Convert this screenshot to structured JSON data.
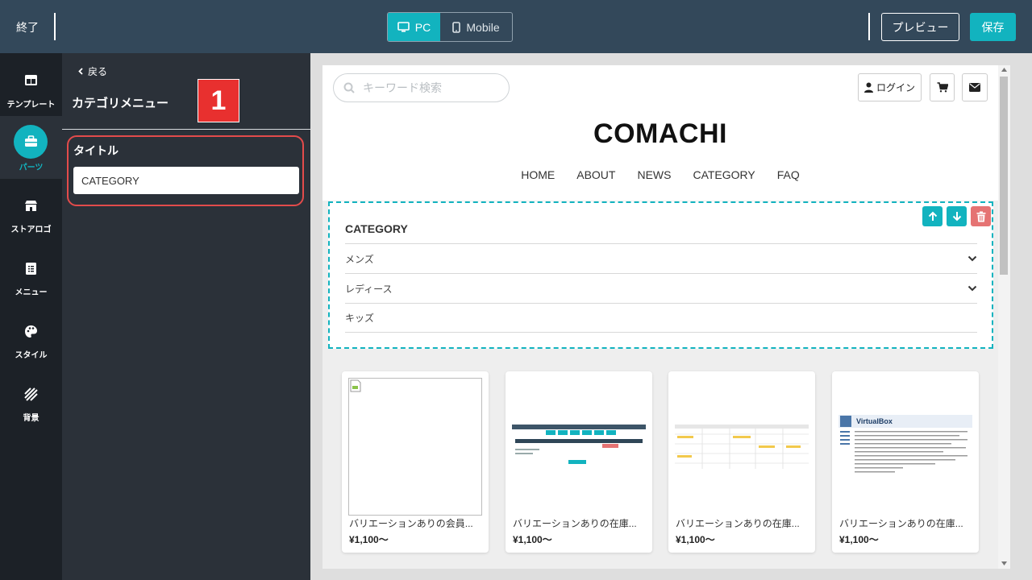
{
  "topbar": {
    "exit_label": "終了",
    "device_pc": "PC",
    "device_mobile": "Mobile",
    "preview_label": "プレビュー",
    "save_label": "保存",
    "accent_color": "#12b3bf"
  },
  "rail": {
    "items": [
      {
        "label": "テンプレート",
        "icon": "layout-icon"
      },
      {
        "label": "パーツ",
        "icon": "toolbox-icon",
        "active": true
      },
      {
        "label": "ストアロゴ",
        "icon": "store-icon"
      },
      {
        "label": "メニュー",
        "icon": "menu-list-icon"
      },
      {
        "label": "スタイル",
        "icon": "palette-icon"
      },
      {
        "label": "背景",
        "icon": "stripes-icon"
      }
    ]
  },
  "panel": {
    "back_label": "戻る",
    "title": "カテゴリメニュー",
    "step_badge": "1",
    "field_label": "タイトル",
    "field_value": "CATEGORY"
  },
  "site": {
    "search_placeholder": "キーワード検索",
    "login_label": "ログイン",
    "logo": "COMACHI",
    "nav": [
      "HOME",
      "ABOUT",
      "NEWS",
      "CATEGORY",
      "FAQ"
    ],
    "category_title": "CATEGORY",
    "categories": [
      "メンズ",
      "レディース",
      "キッズ"
    ],
    "products": [
      {
        "name": "バリエーションありの会員...",
        "price": "¥1,100〜"
      },
      {
        "name": "バリエーションありの在庫...",
        "price": "¥1,100〜"
      },
      {
        "name": "バリエーションありの在庫...",
        "price": "¥1,100〜"
      },
      {
        "name": "バリエーションありの在庫...",
        "price": "¥1,100〜"
      }
    ],
    "virtualbox_text": "VirtualBox"
  }
}
